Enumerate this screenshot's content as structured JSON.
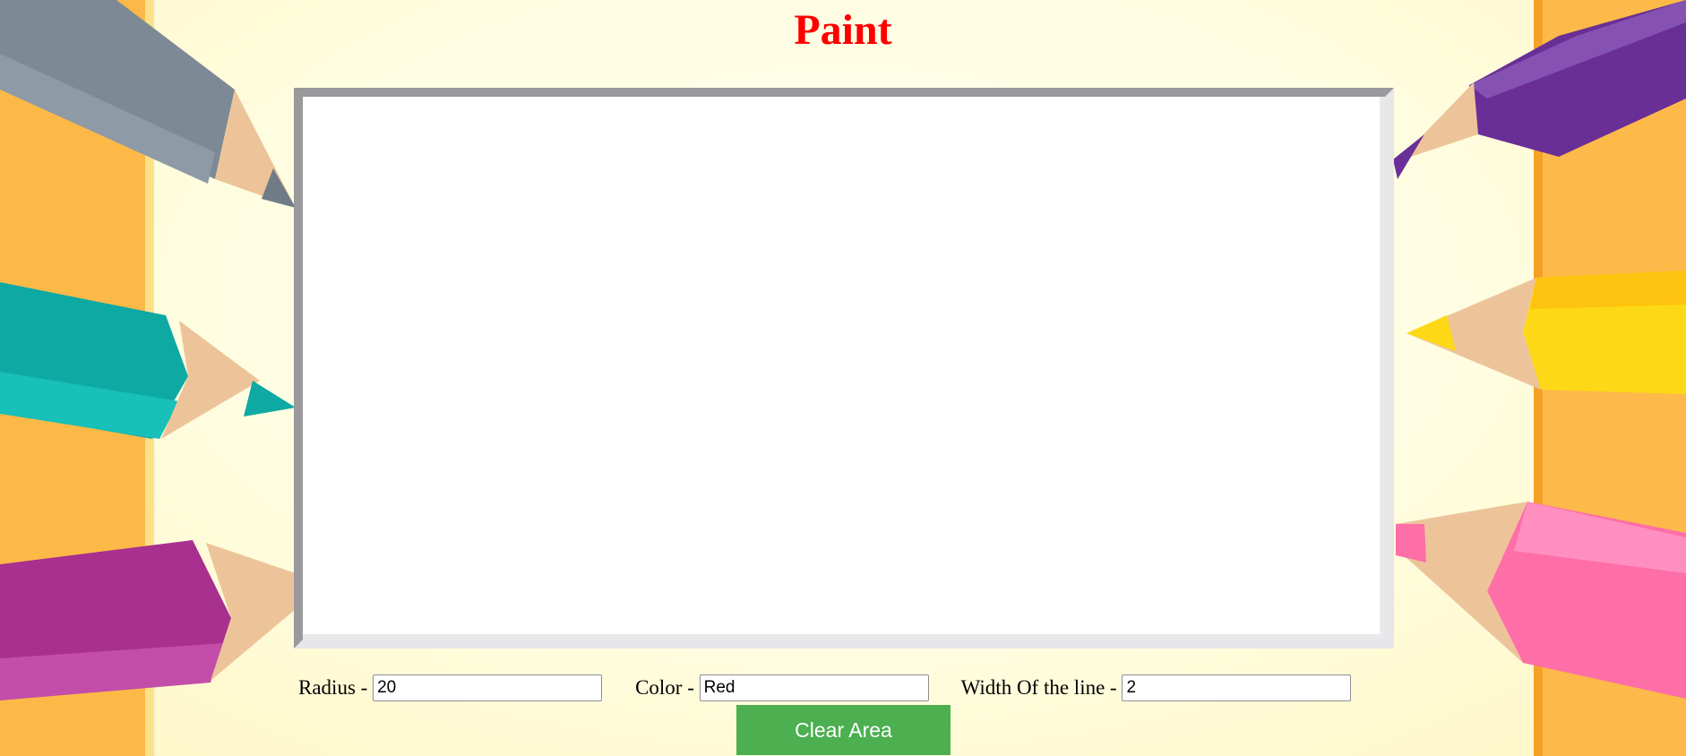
{
  "page": {
    "title": "Paint"
  },
  "canvas": {},
  "controls": {
    "radius": {
      "label": "Radius - ",
      "value": "20"
    },
    "color": {
      "label": "Color - ",
      "value": "Red"
    },
    "line_width": {
      "label": "Width Of the line - ",
      "value": "2"
    }
  },
  "clear_button": {
    "label": "Clear Area",
    "color": "#4caf50"
  },
  "colors": {
    "title": "#ff0000",
    "background": "#fffde0"
  },
  "decorations": [
    "pencil-gray",
    "pencil-teal",
    "pencil-magenta",
    "pencil-purple",
    "pencil-yellow",
    "pencil-pink"
  ]
}
